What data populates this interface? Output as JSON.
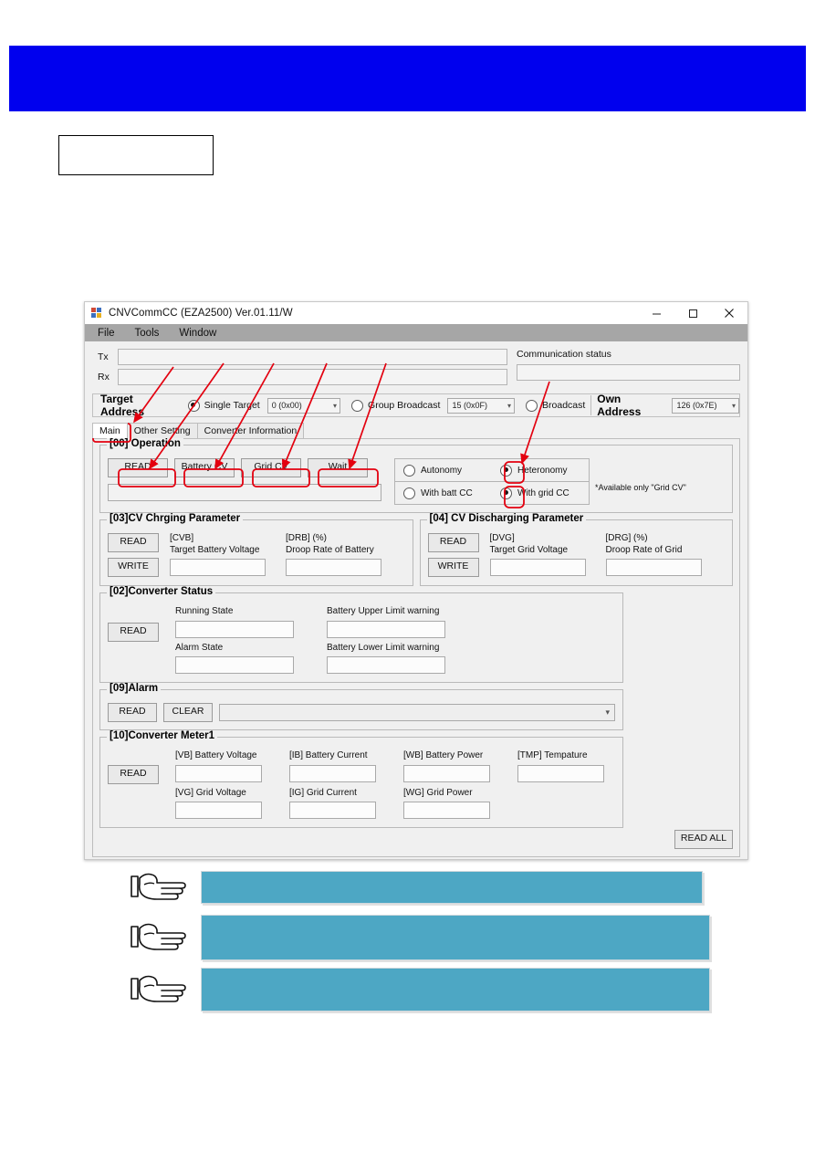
{
  "page": {
    "banner_color": "#0000ee",
    "teal_color": "#4da7c4",
    "annotation_color": "#e3000f"
  },
  "window": {
    "title": "CNVCommCC (EZA2500) Ver.01.11/W",
    "icon": "app-icon",
    "controls": {
      "minimize": "minimize-icon",
      "maximize": "maximize-icon",
      "close": "close-icon"
    },
    "menu": [
      "File",
      "Tools",
      "Window"
    ]
  },
  "io": {
    "tx_label": "Tx",
    "rx_label": "Rx",
    "tx_value": "",
    "rx_value": "",
    "comm_status_label": "Communication status",
    "comm_status_value": ""
  },
  "address_bar": {
    "target_title": "Target Address",
    "single_target_label": "Single Target",
    "single_target_selected": true,
    "single_target_value": "0 (0x00)",
    "group_broadcast_label": "Group Broadcast",
    "group_broadcast_selected": false,
    "group_broadcast_value": "15 (0x0F)",
    "broadcast_label": "Broadcast",
    "broadcast_selected": false,
    "own_title": "Own Address",
    "own_value": "126 (0x7E)"
  },
  "tabs": [
    {
      "label": "Main",
      "active": true
    },
    {
      "label": "Other Setting",
      "active": false
    },
    {
      "label": "Converter Information",
      "active": false
    }
  ],
  "operation": {
    "title": "[00] Operation",
    "buttons": [
      "READ",
      "Battery CV",
      "Grid CV",
      "Wait"
    ],
    "output_value": "",
    "modes": [
      {
        "label": "Autonomy",
        "selected": false
      },
      {
        "label": "Heteronomy",
        "selected": true
      },
      {
        "label": "With batt CC",
        "selected": false
      },
      {
        "label": "With grid CC",
        "selected": true
      }
    ],
    "note": "*Available only \"Grid CV\""
  },
  "cv_charging": {
    "title": "[03]CV Chrging Parameter",
    "read_label": "READ",
    "write_label": "WRITE",
    "fields": [
      {
        "code": "[CVB]",
        "name": "Target Battery Voltage",
        "value": ""
      },
      {
        "code": "[DRB] (%)",
        "name": "Droop Rate of Battery",
        "value": ""
      }
    ]
  },
  "cv_discharging": {
    "title": "[04] CV Discharging Parameter",
    "read_label": "READ",
    "write_label": "WRITE",
    "fields": [
      {
        "code": "[DVG]",
        "name": "Target Grid Voltage",
        "value": ""
      },
      {
        "code": "[DRG] (%)",
        "name": "Droop Rate of Grid",
        "value": ""
      }
    ]
  },
  "converter_status": {
    "title": "[02]Converter Status",
    "read_label": "READ",
    "cells": [
      {
        "name": "Running State",
        "value": ""
      },
      {
        "name": "Battery Upper Limit warning",
        "value": ""
      },
      {
        "name": "Alarm State",
        "value": ""
      },
      {
        "name": "Battery Lower Limit warning",
        "value": ""
      }
    ]
  },
  "alarm": {
    "title": "[09]Alarm",
    "read_label": "READ",
    "clear_label": "CLEAR",
    "selected_value": ""
  },
  "converter_meter": {
    "title": "[10]Converter Meter1",
    "read_label": "READ",
    "row1": [
      {
        "name": "[VB] Battery Voltage",
        "value": ""
      },
      {
        "name": "[IB] Battery Current",
        "value": ""
      },
      {
        "name": "[WB] Battery Power",
        "value": ""
      },
      {
        "name": "[TMP] Tempature",
        "value": ""
      }
    ],
    "row2": [
      {
        "name": "[VG] Grid Voltage",
        "value": ""
      },
      {
        "name": "[IG] Grid Current",
        "value": ""
      },
      {
        "name": "[WG] Grid Power",
        "value": ""
      }
    ],
    "read_all_label": "READ ALL"
  },
  "callouts": {
    "note_box_text": "",
    "bars": [
      {
        "text": ""
      },
      {
        "text": ""
      },
      {
        "text": ""
      }
    ]
  }
}
